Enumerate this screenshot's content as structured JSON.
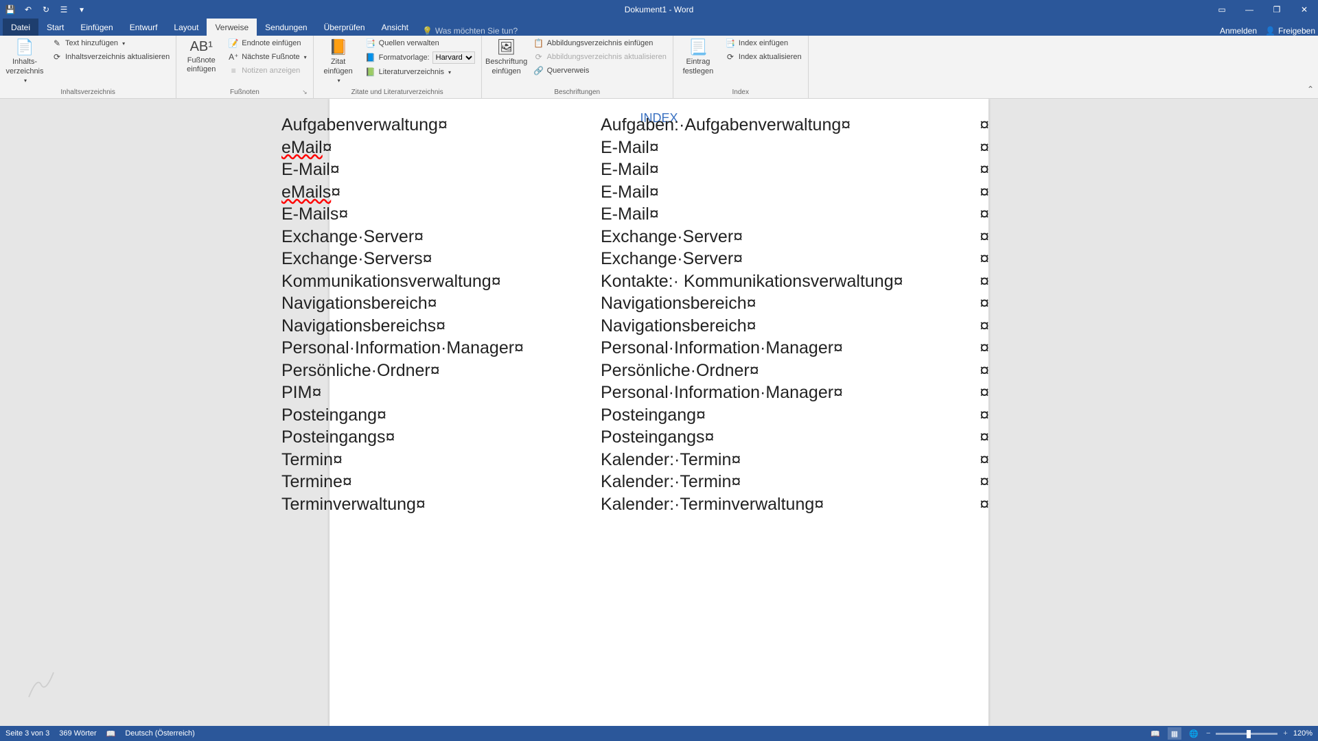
{
  "title": "Dokument1 - Word",
  "tabs": {
    "file": "Datei",
    "items": [
      "Start",
      "Einfügen",
      "Entwurf",
      "Layout",
      "Verweise",
      "Sendungen",
      "Überprüfen",
      "Ansicht"
    ],
    "active": "Verweise",
    "search_placeholder": "Was möchten Sie tun?",
    "signin": "Anmelden",
    "share": "Freigeben"
  },
  "ribbon": {
    "toc": {
      "label": "Inhaltsverzeichnis",
      "big": "Inhalts-\nverzeichnis",
      "add_text": "Text hinzufügen",
      "update": "Inhaltsverzeichnis aktualisieren"
    },
    "footnotes": {
      "label": "Fußnoten",
      "big": "Fußnote\neinfügen",
      "endnote": "Endnote einfügen",
      "next": "Nächste Fußnote",
      "show": "Notizen anzeigen"
    },
    "citations": {
      "label": "Zitate und Literaturverzeichnis",
      "big": "Zitat\neinfügen",
      "manage": "Quellen verwalten",
      "style": "Formatvorlage:",
      "style_value": "Harvard",
      "bibl": "Literaturverzeichnis"
    },
    "captions": {
      "label": "Beschriftungen",
      "big": "Beschriftung\neinfügen",
      "insert_fig": "Abbildungsverzeichnis einfügen",
      "update_fig": "Abbildungsverzeichnis aktualisieren",
      "crossref": "Querverweis"
    },
    "index": {
      "label": "Index",
      "big": "Eintrag\nfestlegen",
      "insert": "Index einfügen",
      "update": "Index aktualisieren"
    }
  },
  "document": {
    "index_title": "INDEX",
    "mark": "¤",
    "rows": [
      {
        "l": "Aufgabenverwaltung",
        "r": "Aufgaben:·Aufgabenverwaltung",
        "spell": false
      },
      {
        "l": "eMail",
        "r": "E-Mail",
        "spell": true
      },
      {
        "l": "E-Mail",
        "r": "E-Mail",
        "spell": false
      },
      {
        "l": "eMails",
        "r": "E-Mail",
        "spell": true
      },
      {
        "l": "E-Mails",
        "r": "E-Mail",
        "spell": false
      },
      {
        "l": "Exchange·Server",
        "r": "Exchange·Server",
        "spell": false
      },
      {
        "l": "Exchange·Servers",
        "r": "Exchange·Server",
        "spell": false
      },
      {
        "l": "Kommunikationsverwaltung",
        "r": "Kontakte:· Kommunikationsverwaltung",
        "spell": false
      },
      {
        "l": "Navigationsbereich",
        "r": "Navigationsbereich",
        "spell": false
      },
      {
        "l": "Navigationsbereichs",
        "r": "Navigationsbereich",
        "spell": false
      },
      {
        "l": "Personal·Information·Manager",
        "r": "Personal·Information·Manager",
        "spell": false
      },
      {
        "l": "Persönliche·Ordner",
        "r": "Persönliche·Ordner",
        "spell": false
      },
      {
        "l": "PIM",
        "r": "Personal·Information·Manager",
        "spell": false
      },
      {
        "l": "Posteingang",
        "r": "Posteingang",
        "spell": false
      },
      {
        "l": "Posteingangs",
        "r": "Posteingangs",
        "spell": false
      },
      {
        "l": "Termin",
        "r": "Kalender:·Termin",
        "spell": false
      },
      {
        "l": "Termine",
        "r": "Kalender:·Termin",
        "spell": false
      },
      {
        "l": "Terminverwaltung",
        "r": "Kalender:·Terminverwaltung",
        "spell": false
      }
    ]
  },
  "statusbar": {
    "page": "Seite 3 von 3",
    "words": "369 Wörter",
    "lang": "Deutsch (Österreich)",
    "zoom": "120%"
  }
}
